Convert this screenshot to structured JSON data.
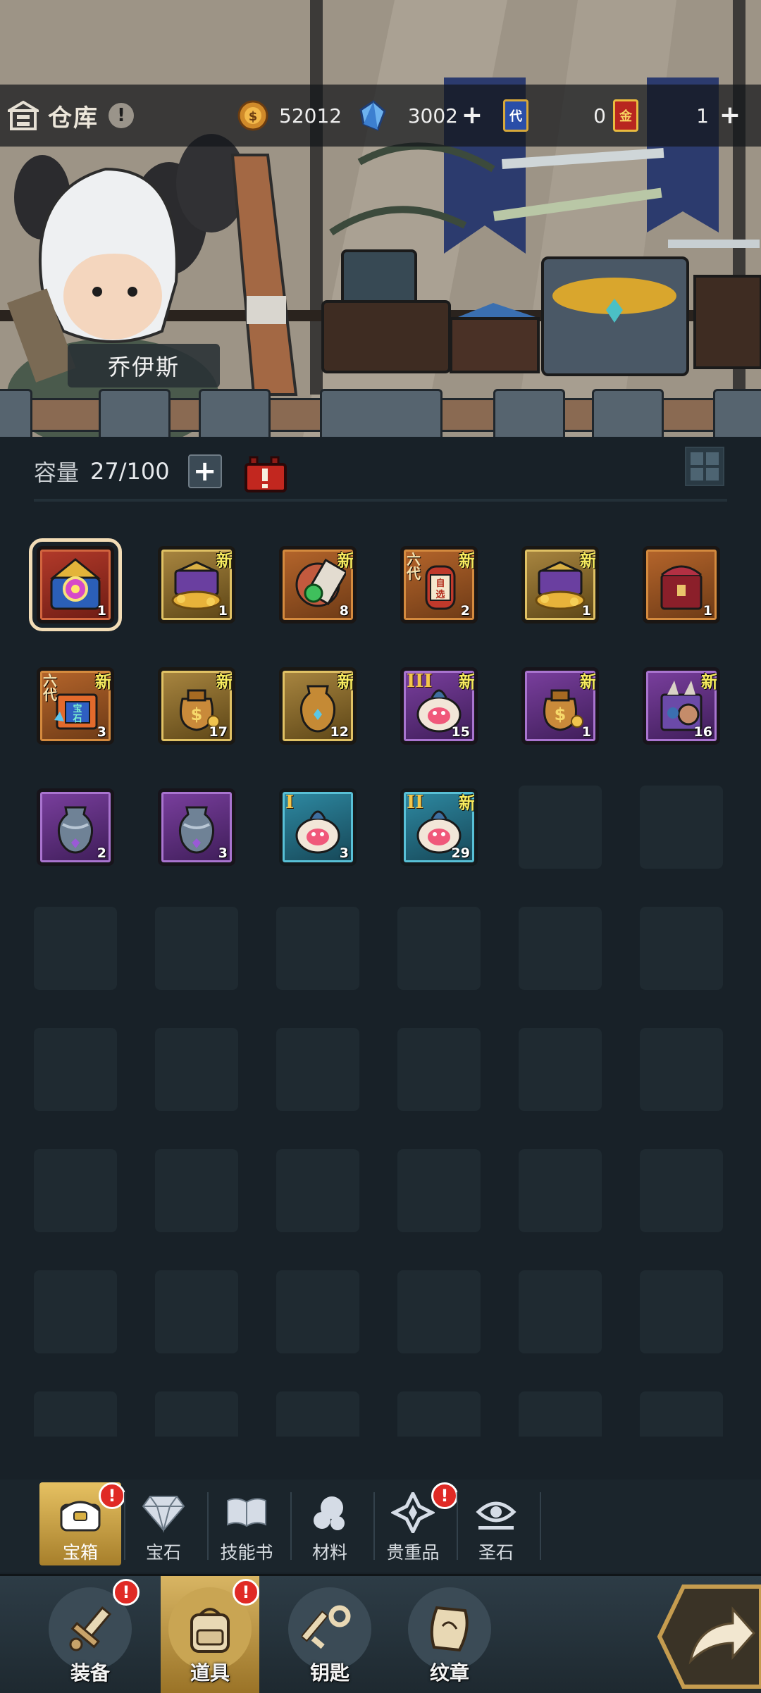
{
  "header": {
    "title": "仓库",
    "character_name": "乔伊斯"
  },
  "currencies": {
    "gold": "52012",
    "crystal": "3002",
    "ticket_blue": "0",
    "ticket_gold": "1",
    "ticket_blue_label": "代",
    "ticket_gold_label": "金"
  },
  "capacity": {
    "label": "容量",
    "value": "27/100"
  },
  "items": [
    {
      "count": "1",
      "quality": "red",
      "new": false,
      "selected": true,
      "art": "chest-emblem"
    },
    {
      "count": "1",
      "quality": "gold",
      "new": true,
      "art": "gold-chest"
    },
    {
      "count": "8",
      "quality": "orange",
      "new": true,
      "art": "herb-scroll"
    },
    {
      "count": "2",
      "quality": "orange",
      "new": true,
      "art": "selection-jar",
      "gen": "六代",
      "mark": "自选"
    },
    {
      "count": "1",
      "quality": "gold",
      "new": true,
      "art": "gold-chest"
    },
    {
      "count": "1",
      "quality": "orange",
      "new": false,
      "art": "red-chest"
    },
    {
      "count": "3",
      "quality": "orange",
      "new": true,
      "art": "gem-pack",
      "gen": "六代",
      "mark": "宝石"
    },
    {
      "count": "17",
      "quality": "gold",
      "new": true,
      "art": "money-bag"
    },
    {
      "count": "12",
      "quality": "gold",
      "new": true,
      "art": "gold-vase"
    },
    {
      "count": "15",
      "quality": "purple",
      "new": true,
      "art": "potion-sack",
      "tier": "III"
    },
    {
      "count": "1",
      "quality": "purple",
      "new": true,
      "art": "money-bag"
    },
    {
      "count": "16",
      "quality": "purple",
      "new": true,
      "art": "claw-chest"
    },
    {
      "count": "2",
      "quality": "purple",
      "new": false,
      "art": "silver-vase"
    },
    {
      "count": "3",
      "quality": "purple",
      "new": false,
      "art": "silver-vase"
    },
    {
      "count": "3",
      "quality": "blue",
      "new": false,
      "art": "potion-sack",
      "tier": "I"
    },
    {
      "count": "29",
      "quality": "blue",
      "new": true,
      "art": "potion-sack",
      "tier": "II"
    }
  ],
  "new_label": "新",
  "category_tabs": [
    {
      "label": "宝箱",
      "active": true,
      "badge": true,
      "icon": "chest-icon"
    },
    {
      "label": "宝石",
      "active": false,
      "badge": false,
      "icon": "gem-icon"
    },
    {
      "label": "技能书",
      "active": false,
      "badge": false,
      "icon": "book-icon"
    },
    {
      "label": "材料",
      "active": false,
      "badge": false,
      "icon": "material-icon"
    },
    {
      "label": "贵重品",
      "active": false,
      "badge": true,
      "icon": "valuable-icon"
    },
    {
      "label": "圣石",
      "active": false,
      "badge": false,
      "icon": "holy-stone-icon"
    }
  ],
  "bottom_nav": [
    {
      "label": "装备",
      "active": false,
      "badge": true,
      "icon": "sword-icon"
    },
    {
      "label": "道具",
      "active": true,
      "badge": true,
      "icon": "backpack-icon"
    },
    {
      "label": "钥匙",
      "active": false,
      "badge": false,
      "icon": "key-icon"
    },
    {
      "label": "纹章",
      "active": false,
      "badge": false,
      "icon": "emblem-icon"
    }
  ],
  "badge_mark": "!",
  "colors": {
    "background": "#182128",
    "new_text": "#f6ea5e",
    "badge": "#e02a25",
    "active_tab": "#e6c162"
  }
}
